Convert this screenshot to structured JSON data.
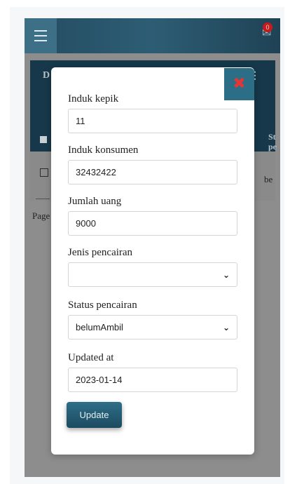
{
  "topbar": {
    "menu_icon": "hamburger-icon",
    "mail_icon": "mail-icon",
    "notification_count": "0"
  },
  "table": {
    "heading_partial": "D",
    "header_menu_icon": "kebab-icon",
    "column_partial": "St pe",
    "row_value_partial": "be",
    "pagination_partial": "Page"
  },
  "modal": {
    "close_icon": "close-icon",
    "close_color": "#e53535",
    "fields": {
      "induk_kepik": {
        "label": "Induk kepik",
        "value": "11"
      },
      "induk_konsumen": {
        "label": "Induk konsumen",
        "value": "32432422"
      },
      "jumlah_uang": {
        "label": "Jumlah uang",
        "value": "9000"
      },
      "jenis_pencairan": {
        "label": "Jenis pencairan",
        "value": ""
      },
      "status_pencairan": {
        "label": "Status pencairan",
        "value": "belumAmbil"
      },
      "updated_at": {
        "label": "Updated at",
        "value": "2023-01-14"
      }
    },
    "update_label": "Update"
  },
  "colors": {
    "topbar": "#2d5d74",
    "table_header": "#16384a",
    "button": "#2e6e88"
  }
}
